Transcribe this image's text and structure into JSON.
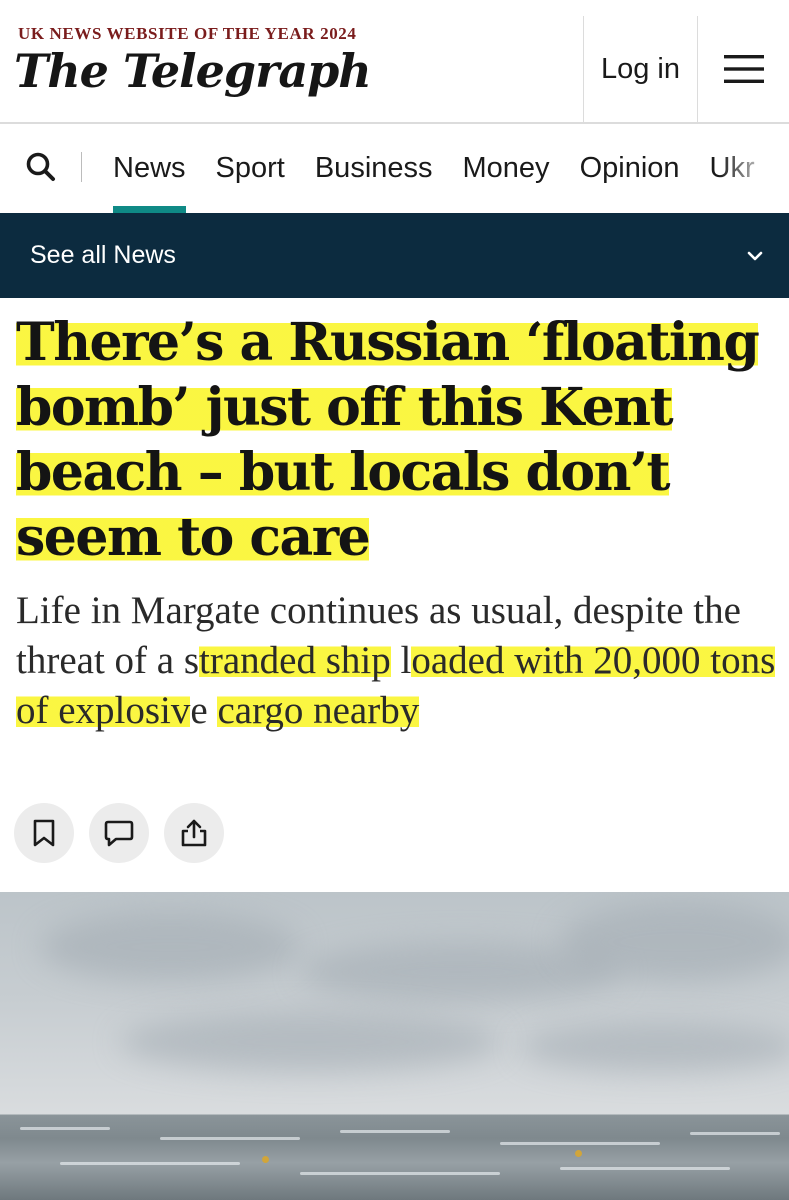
{
  "header": {
    "award": "UK NEWS WEBSITE OF THE YEAR 2024",
    "masthead": "The Telegraph",
    "login_label": "Log in"
  },
  "nav": {
    "items": [
      {
        "label": "News",
        "active": true
      },
      {
        "label": "Sport"
      },
      {
        "label": "Business"
      },
      {
        "label": "Money"
      },
      {
        "label": "Opinion"
      },
      {
        "label": "Ukr"
      }
    ]
  },
  "section_bar": {
    "label": "See all News"
  },
  "article": {
    "headline": "There’s a Russian ‘floating bomb’ just off this Kent beach – but locals don’t seem to care",
    "standfirst_plain": "Life in Margate continues as usual, despite the threat of a s",
    "standfirst_highlight_1": "tranded ship",
    "standfirst_mid": " l",
    "standfirst_highlight_2": "oaded with 20,000 tons of explosiv",
    "standfirst_tail": "e ",
    "standfirst_highlight_3": "cargo nearby"
  },
  "actions": [
    "bookmark-icon",
    "comment-icon",
    "share-icon"
  ],
  "colors": {
    "award": "#7a1c1c",
    "nav_active": "#0f8a86",
    "section_bar": "#0c2b3f",
    "highlight": "#faf528"
  }
}
